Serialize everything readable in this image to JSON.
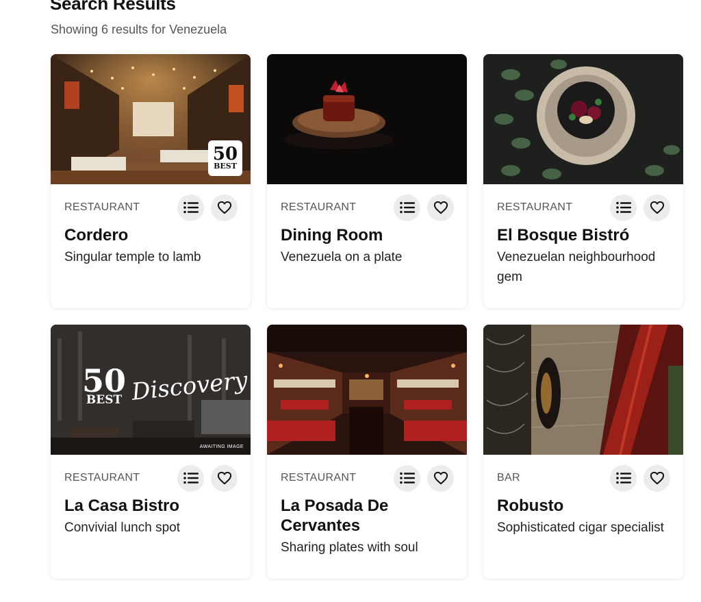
{
  "header": {
    "title": "Search Results",
    "subtitle": "Showing 6 results for Venezuela"
  },
  "cards": [
    {
      "category": "RESTAURANT",
      "name": "Cordero",
      "tagline": "Singular temple to lamb",
      "badge": {
        "line1": "50",
        "line2": "BEST"
      }
    },
    {
      "category": "RESTAURANT",
      "name": "Dining Room",
      "tagline": "Venezuela on a plate"
    },
    {
      "category": "RESTAURANT",
      "name": "El Bosque Bistró",
      "tagline": "Venezuelan neighbourhood gem"
    },
    {
      "category": "RESTAURANT",
      "name": "La Casa Bistro",
      "tagline": "Convivial lunch spot",
      "overlay": {
        "logo_top": "50",
        "logo_bottom": "BEST",
        "script": "Discovery",
        "note": "AWAITING IMAGE"
      }
    },
    {
      "category": "RESTAURANT",
      "name": "La Posada De Cervantes",
      "tagline": "Sharing plates with soul"
    },
    {
      "category": "BAR",
      "name": "Robusto",
      "tagline": "Sophisticated cigar specialist"
    }
  ],
  "icons": {
    "list": "list-icon",
    "favorite": "heart-icon"
  }
}
